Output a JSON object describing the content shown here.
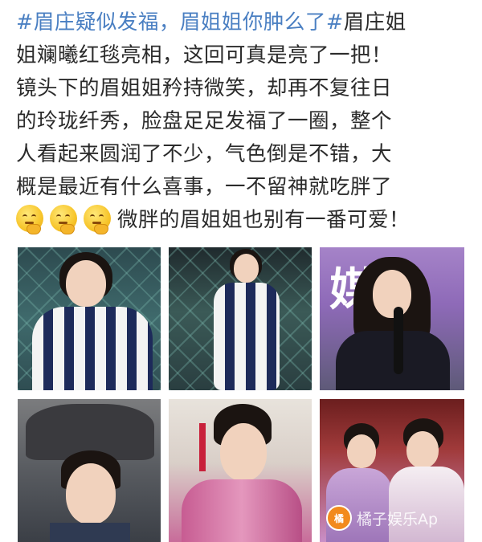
{
  "post": {
    "hashtag": "#眉庄疑似发福，眉姐姐你肿么了#",
    "lines": [
      "眉庄姐",
      "姐斓曦红毯亮相，这回可真是亮了一把！",
      "镜头下的眉姐姐矜持微笑，却再不复往日",
      "的玲珑纤秀，脸盘足足发福了一圈，整个",
      "人看起来圆润了不少，气色倒是不错，大",
      "概是最近有什么喜事，一不留神就吃胖了"
    ],
    "last_line": "微胖的眉姐姐也别有一番可爱！",
    "emojis": [
      "thinking-face-icon",
      "thinking-face-icon",
      "thinking-face-icon"
    ]
  },
  "photos": {
    "p3_sign_text": "媒体",
    "watermark_text": "橘子娱乐Ap",
    "watermark_logo": "橘"
  },
  "colors": {
    "hashtag": "#4a7fc2",
    "text": "#2b2b2b"
  }
}
